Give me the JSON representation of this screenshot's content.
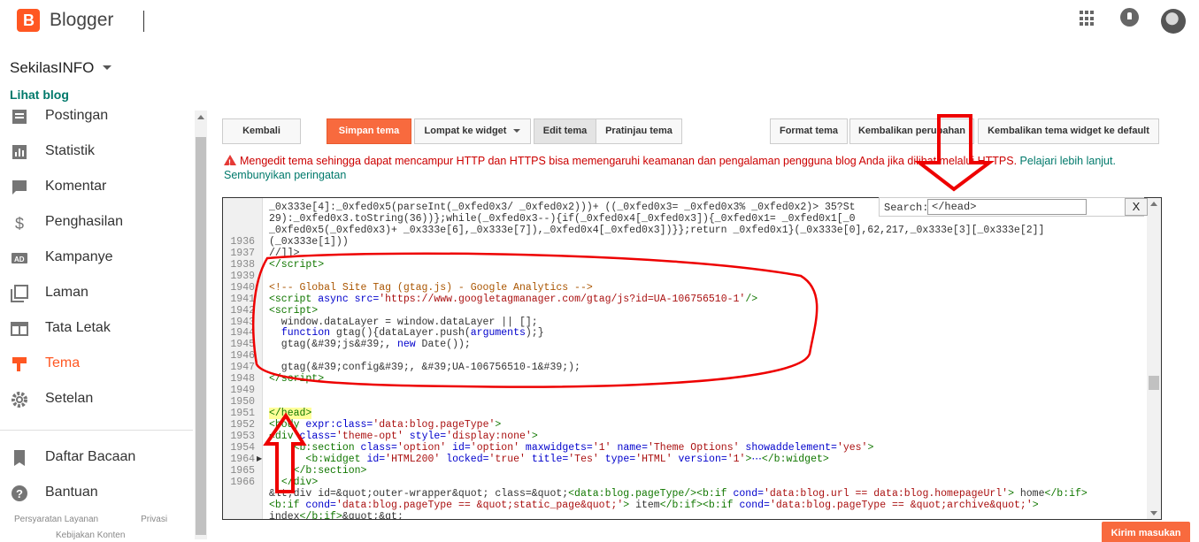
{
  "app": {
    "name": "Blogger",
    "logo_letter": "B"
  },
  "header": {
    "apps_icon": "apps-grid-icon",
    "notifications_icon": "bell-icon",
    "avatar": "user-avatar"
  },
  "sidebar": {
    "blog_name": "SekilasINFO",
    "view_blog": "Lihat blog",
    "items": [
      {
        "label": "Postingan",
        "icon": "posts-icon"
      },
      {
        "label": "Statistik",
        "icon": "stats-icon"
      },
      {
        "label": "Komentar",
        "icon": "comment-icon"
      },
      {
        "label": "Penghasilan",
        "icon": "dollar-icon"
      },
      {
        "label": "Kampanye",
        "icon": "ad-icon"
      },
      {
        "label": "Laman",
        "icon": "pages-icon"
      },
      {
        "label": "Tata Letak",
        "icon": "layout-icon"
      },
      {
        "label": "Tema",
        "icon": "theme-icon",
        "active": true
      },
      {
        "label": "Setelan",
        "icon": "gear-icon"
      },
      {
        "label": "Daftar Bacaan",
        "icon": "bookmark-icon"
      },
      {
        "label": "Bantuan",
        "icon": "help-icon"
      }
    ],
    "footer": {
      "terms": "Persyaratan Layanan",
      "privacy": "Privasi",
      "content_policy": "Kebijakan Konten"
    }
  },
  "toolbar": {
    "back": "Kembali",
    "save": "Simpan tema",
    "jump_widget": "Lompat ke widget",
    "edit_theme": "Edit tema",
    "preview_theme": "Pratinjau tema",
    "format_theme": "Format tema",
    "revert_changes": "Kembalikan perubahan",
    "revert_widget": "Kembalikan tema widget ke default"
  },
  "warning": {
    "message": "Mengedit tema sehingga dapat mencampur HTTP dan HTTPS bisa memengaruhi keamanan dan pengalaman pengguna blog Anda jika dilihat melalui HTTPS.",
    "learn_more": "Pelajari lebih lanjut.",
    "dismiss": "Sembunyikan peringatan"
  },
  "search": {
    "label": "Search:",
    "value": "</head>",
    "close": "X"
  },
  "editor": {
    "lines": [
      {
        "n": "",
        "html": "_0x333e[4]:_0xfed0x5(parseInt(_0xfed0x3/ _0xfed0x2)))+ ((_0xfed0x3= _0xfed0x3% _0xfed0x2)> 35?St"
      },
      {
        "n": "",
        "html": "29):_0xfed0x3.toString(36))};while(_0xfed0x3--){if(_0xfed0x4[_0xfed0x3]){_0xfed0x1= _0xfed0x1[_0"
      },
      {
        "n": "",
        "html": "_0xfed0x5(_0xfed0x3)+ _0x333e[6],_0x333e[7]),_0xfed0x4[_0xfed0x3])}};return _0xfed0x1}(_0x333e[0],62,217,_0x333e[3][_0x333e[2]]"
      },
      {
        "n": "1936",
        "html": "(_0x333e[1]))"
      },
      {
        "n": "1937",
        "html": "//]]>"
      },
      {
        "n": "1938",
        "html": "<span class='c-tag'>&lt;/script&gt;</span>"
      },
      {
        "n": "1939",
        "html": ""
      },
      {
        "n": "1940",
        "html": "<span class='c-cmt'>&lt;!-- Global Site Tag (gtag.js) - Google Analytics --&gt;</span>"
      },
      {
        "n": "1941",
        "html": "<span class='c-tag'>&lt;script</span> <span class='c-attr'>async</span> <span class='c-attr'>src=</span><span class='c-str'>'https://www.googletagmanager.com/gtag/js?id=UA-106756510-1'</span><span class='c-tag'>/&gt;</span>"
      },
      {
        "n": "1942",
        "html": "<span class='c-tag'>&lt;script&gt;</span>"
      },
      {
        "n": "1943",
        "html": "  window.dataLayer = window.dataLayer || [];"
      },
      {
        "n": "1944",
        "html": "  <span class='c-attr'>function</span> gtag(){dataLayer.push(<span class='c-attr'>arguments</span>);}"
      },
      {
        "n": "1945",
        "html": "  gtag(&amp;#39;js&amp;#39;, <span class='c-attr'>new</span> Date());"
      },
      {
        "n": "1946",
        "html": ""
      },
      {
        "n": "1947",
        "html": "  gtag(&amp;#39;config&amp;#39;, &amp;#39;UA-106756510-1&amp;#39;);"
      },
      {
        "n": "1948",
        "html": "<span class='c-tag'>&lt;/script&gt;</span>"
      },
      {
        "n": "1949",
        "html": ""
      },
      {
        "n": "1950",
        "html": ""
      },
      {
        "n": "1951",
        "html": "<span class='c-tag hl'>&lt;/head&gt;</span>"
      },
      {
        "n": "1952",
        "html": "<span class='c-tag'>&lt;body</span> <span class='c-attr'>expr:class=</span><span class='c-str'>'data:blog.pageType'</span><span class='c-tag'>&gt;</span>"
      },
      {
        "n": "1953",
        "html": "<span class='c-tag'>&lt;div</span> <span class='c-attr'>class=</span><span class='c-str'>'theme-opt'</span> <span class='c-attr'>style=</span><span class='c-str'>'display:none'</span><span class='c-tag'>&gt;</span>"
      },
      {
        "n": "1954",
        "html": "    <span class='c-tag'>&lt;b:section</span> <span class='c-attr'>class=</span><span class='c-str'>'option'</span> <span class='c-attr'>id=</span><span class='c-str'>'option'</span> <span class='c-attr'>maxwidgets=</span><span class='c-str'>'1'</span> <span class='c-attr'>name=</span><span class='c-str'>'Theme Options'</span> <span class='c-attr'>showaddelement=</span><span class='c-str'>'yes'</span><span class='c-tag'>&gt;</span>"
      },
      {
        "n": "1964",
        "html": "      <span class='c-tag'>&lt;b:widget</span> <span class='c-attr'>id=</span><span class='c-str'>'HTML200'</span> <span class='c-attr'>locked=</span><span class='c-str'>'true'</span> <span class='c-attr'>title=</span><span class='c-str'>'Tes'</span> <span class='c-attr'>type=</span><span class='c-str'>'HTML'</span> <span class='c-attr'>version=</span><span class='c-str'>'1'</span><span class='c-tag'>&gt;</span><span class='c-attr'>⋯</span><span class='c-tag'>&lt;/b:widget&gt;</span>"
      },
      {
        "n": "1965",
        "html": "    <span class='c-tag'>&lt;/b:section&gt;</span>"
      },
      {
        "n": "1966",
        "html": "  <span class='c-tag'>&lt;/div&gt;</span>"
      },
      {
        "n": "",
        "html": "&amp;lt;div id=&amp;quot;outer-wrapper&amp;quot; class=&amp;quot;<span class='c-tag'>&lt;data:blog.pageType/&gt;&lt;b:if</span> <span class='c-attr'>cond=</span><span class='c-str'>'data:blog.url == data:blog.homepageUrl'</span><span class='c-tag'>&gt;</span> home<span class='c-tag'>&lt;/b:if&gt;</span>"
      },
      {
        "n": "",
        "html": "<span class='c-tag'>&lt;b:if</span> <span class='c-attr'>cond=</span><span class='c-str'>'data:blog.pageType == &amp;quot;static_page&amp;quot;'</span><span class='c-tag'>&gt;</span> item<span class='c-tag'>&lt;/b:if&gt;&lt;b:if</span> <span class='c-attr'>cond=</span><span class='c-str'>'data:blog.pageType == &amp;quot;archive&amp;quot;'</span><span class='c-tag'>&gt;</span>"
      },
      {
        "n": "",
        "html": "index<span class='c-tag'>&lt;/b:if&gt;</span>&amp;quot;&amp;gt;"
      }
    ]
  },
  "feedback": "Kirim masukan"
}
